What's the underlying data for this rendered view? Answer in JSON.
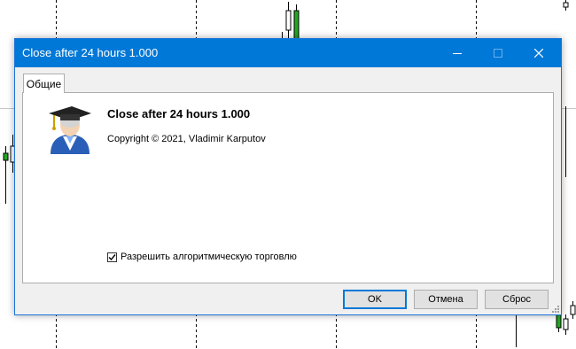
{
  "window": {
    "title": "Close after 24 hours 1.000",
    "controls": [
      "minimize-icon",
      "maximize-icon",
      "close-icon"
    ]
  },
  "tabs": [
    {
      "label": "Общие",
      "selected": true
    }
  ],
  "expert": {
    "name": "Close after 24 hours 1.000",
    "copyright": "Copyright © 2021, Vladimir Karputov",
    "icon": "expert-advisor-graduate-icon"
  },
  "options": {
    "allow_algo_trading": {
      "label": "Разрешить алгоритмическую торговлю",
      "checked": true
    }
  },
  "buttons": {
    "ok": "OK",
    "cancel": "Отмена",
    "reset": "Сброс"
  },
  "colors": {
    "titlebar": "#0078d7",
    "candle_bull": "#22a822",
    "candle_bear": "#000000",
    "dialog_bg": "#f0f0f0"
  }
}
